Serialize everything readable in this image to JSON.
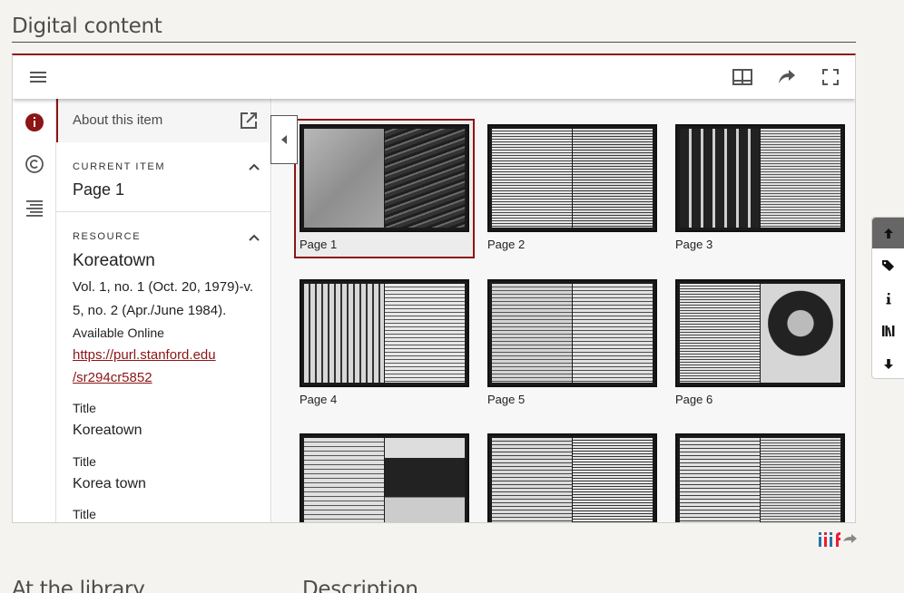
{
  "headings": {
    "digital_content": "Digital content",
    "at_the_library": "At the library",
    "description": "Description"
  },
  "viewer": {
    "toolbar_icons": [
      "menu-icon",
      "book-view-icon",
      "share-icon",
      "fullscreen-icon"
    ],
    "panel": {
      "about_label": "About this item",
      "current_item_label": "CURRENT ITEM",
      "current_item_value": "Page 1",
      "resource_label": "RESOURCE",
      "resource_title": "Koreatown",
      "resource_dates": "Vol. 1, no. 1 (Oct. 20, 1979)-v. 5, no. 2 (Apr./June 1984).",
      "available_online_label": "Available Online",
      "purl_line1": "https://purl.stanford.edu",
      "purl_line2": "/sr294cr5852",
      "fields": [
        {
          "label": "Title",
          "value": "Koreatown"
        },
        {
          "label": "Title",
          "value": "Korea town"
        },
        {
          "label": "Title",
          "value": ""
        }
      ]
    },
    "pages": [
      {
        "label": "Page 1",
        "selected": true
      },
      {
        "label": "Page 2",
        "selected": false
      },
      {
        "label": "Page 3",
        "selected": false
      },
      {
        "label": "Page 4",
        "selected": false
      },
      {
        "label": "Page 5",
        "selected": false
      },
      {
        "label": "Page 6",
        "selected": false
      },
      {
        "label": "",
        "selected": false
      },
      {
        "label": "",
        "selected": false
      },
      {
        "label": "",
        "selected": false
      }
    ]
  },
  "side_nav_icons": [
    "arrow-up-icon",
    "tags-icon",
    "info-icon",
    "library-icon",
    "arrow-down-icon"
  ],
  "iiif_logo": "iiif",
  "colors": {
    "accent": "#8c1515",
    "iiif_blue": "#2873ab",
    "iiif_red": "#ed1d33"
  }
}
